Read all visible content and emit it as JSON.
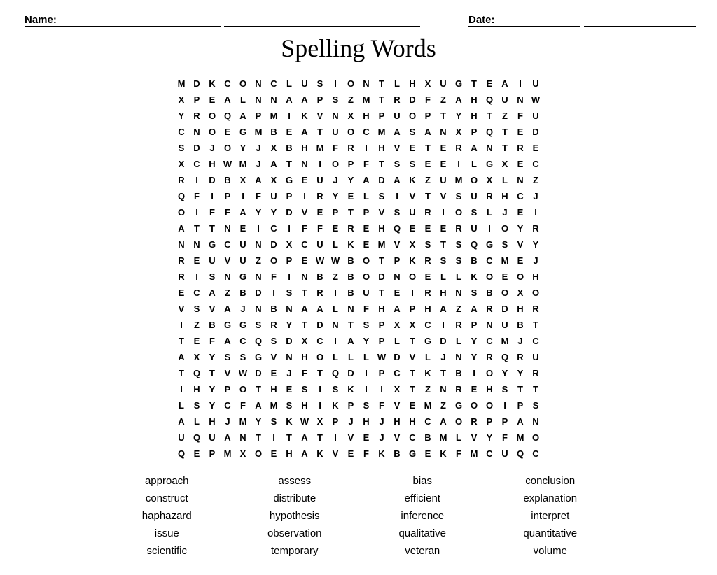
{
  "header": {
    "name_label": "Name:",
    "date_label": "Date:"
  },
  "title": "Spelling Words",
  "grid": [
    [
      "M",
      "D",
      "K",
      "C",
      "O",
      "N",
      "C",
      "L",
      "U",
      "S",
      "I",
      "O",
      "N",
      "T",
      "L",
      "H",
      "X",
      "U",
      "G",
      "T",
      "E",
      "A",
      "I",
      "U",
      "",
      ""
    ],
    [
      "X",
      "P",
      "E",
      "A",
      "L",
      "N",
      "N",
      "A",
      "A",
      "P",
      "S",
      "Z",
      "M",
      "T",
      "R",
      "D",
      "F",
      "Z",
      "A",
      "H",
      "Q",
      "U",
      "N",
      "W",
      "",
      ""
    ],
    [
      "Y",
      "R",
      "O",
      "Q",
      "A",
      "P",
      "M",
      "I",
      "K",
      "V",
      "N",
      "X",
      "H",
      "P",
      "U",
      "O",
      "P",
      "T",
      "Y",
      "H",
      "T",
      "Z",
      "F",
      "U",
      "",
      ""
    ],
    [
      "C",
      "N",
      "O",
      "E",
      "G",
      "M",
      "B",
      "E",
      "A",
      "T",
      "U",
      "O",
      "C",
      "M",
      "A",
      "S",
      "A",
      "N",
      "X",
      "P",
      "Q",
      "T",
      "E",
      "D",
      "",
      ""
    ],
    [
      "S",
      "D",
      "J",
      "O",
      "Y",
      "J",
      "X",
      "B",
      "H",
      "M",
      "F",
      "R",
      "I",
      "H",
      "V",
      "E",
      "T",
      "E",
      "R",
      "A",
      "N",
      "T",
      "R",
      "E",
      "",
      ""
    ],
    [
      "X",
      "C",
      "H",
      "W",
      "M",
      "J",
      "A",
      "T",
      "N",
      "I",
      "O",
      "P",
      "F",
      "T",
      "S",
      "S",
      "E",
      "E",
      "I",
      "L",
      "G",
      "X",
      "E",
      "C",
      "",
      ""
    ],
    [
      "R",
      "I",
      "D",
      "B",
      "X",
      "A",
      "X",
      "G",
      "E",
      "U",
      "J",
      "Y",
      "A",
      "D",
      "A",
      "K",
      "Z",
      "U",
      "M",
      "O",
      "X",
      "L",
      "N",
      "Z",
      "",
      ""
    ],
    [
      "Q",
      "F",
      "I",
      "P",
      "I",
      "F",
      "U",
      "P",
      "I",
      "R",
      "Y",
      "E",
      "L",
      "S",
      "I",
      "V",
      "T",
      "V",
      "S",
      "U",
      "R",
      "H",
      "C",
      "J",
      "",
      ""
    ],
    [
      "O",
      "I",
      "F",
      "F",
      "A",
      "Y",
      "Y",
      "D",
      "V",
      "E",
      "P",
      "T",
      "P",
      "V",
      "S",
      "U",
      "R",
      "I",
      "O",
      "S",
      "L",
      "J",
      "E",
      "I",
      "",
      ""
    ],
    [
      "A",
      "T",
      "T",
      "N",
      "E",
      "I",
      "C",
      "I",
      "F",
      "F",
      "E",
      "R",
      "E",
      "H",
      "Q",
      "E",
      "E",
      "E",
      "R",
      "U",
      "I",
      "O",
      "Y",
      "R",
      "",
      ""
    ],
    [
      "N",
      "N",
      "G",
      "C",
      "U",
      "N",
      "D",
      "X",
      "C",
      "U",
      "L",
      "K",
      "E",
      "M",
      "V",
      "X",
      "S",
      "T",
      "S",
      "Q",
      "G",
      "S",
      "V",
      "Y",
      "",
      ""
    ],
    [
      "R",
      "E",
      "U",
      "V",
      "U",
      "Z",
      "O",
      "P",
      "E",
      "W",
      "W",
      "B",
      "O",
      "T",
      "P",
      "K",
      "R",
      "S",
      "S",
      "B",
      "C",
      "M",
      "E",
      "J",
      "",
      ""
    ],
    [
      "R",
      "I",
      "S",
      "N",
      "G",
      "N",
      "F",
      "I",
      "N",
      "B",
      "Z",
      "B",
      "O",
      "D",
      "N",
      "O",
      "E",
      "L",
      "L",
      "K",
      "O",
      "E",
      "O",
      "H",
      "",
      ""
    ],
    [
      "E",
      "C",
      "A",
      "Z",
      "B",
      "D",
      "I",
      "S",
      "T",
      "R",
      "I",
      "B",
      "U",
      "T",
      "E",
      "I",
      "R",
      "H",
      "N",
      "S",
      "B",
      "O",
      "X",
      "O",
      "",
      ""
    ],
    [
      "V",
      "S",
      "V",
      "A",
      "J",
      "N",
      "B",
      "N",
      "A",
      "A",
      "L",
      "N",
      "F",
      "H",
      "A",
      "P",
      "H",
      "A",
      "Z",
      "A",
      "R",
      "D",
      "H",
      "R",
      "",
      ""
    ],
    [
      "I",
      "Z",
      "B",
      "G",
      "G",
      "S",
      "R",
      "Y",
      "T",
      "D",
      "N",
      "T",
      "S",
      "P",
      "X",
      "X",
      "C",
      "I",
      "R",
      "P",
      "N",
      "U",
      "B",
      "T",
      "",
      ""
    ],
    [
      "T",
      "E",
      "F",
      "A",
      "C",
      "Q",
      "S",
      "D",
      "X",
      "C",
      "I",
      "A",
      "Y",
      "P",
      "L",
      "T",
      "G",
      "D",
      "L",
      "Y",
      "C",
      "M",
      "J",
      "C",
      "",
      ""
    ],
    [
      "A",
      "X",
      "Y",
      "S",
      "S",
      "G",
      "V",
      "N",
      "H",
      "O",
      "L",
      "L",
      "L",
      "W",
      "D",
      "V",
      "L",
      "J",
      "N",
      "Y",
      "R",
      "Q",
      "R",
      "U",
      "",
      ""
    ],
    [
      "T",
      "Q",
      "T",
      "V",
      "W",
      "D",
      "E",
      "J",
      "F",
      "T",
      "Q",
      "D",
      "I",
      "P",
      "C",
      "T",
      "K",
      "T",
      "B",
      "I",
      "O",
      "Y",
      "Y",
      "R",
      "",
      ""
    ],
    [
      "I",
      "H",
      "Y",
      "P",
      "O",
      "T",
      "H",
      "E",
      "S",
      "I",
      "S",
      "K",
      "I",
      "I",
      "X",
      "T",
      "Z",
      "N",
      "R",
      "E",
      "H",
      "S",
      "T",
      "T",
      "",
      ""
    ],
    [
      "L",
      "S",
      "Y",
      "C",
      "F",
      "A",
      "M",
      "S",
      "H",
      "I",
      "K",
      "P",
      "S",
      "F",
      "V",
      "E",
      "M",
      "Z",
      "G",
      "O",
      "O",
      "I",
      "P",
      "S",
      "",
      ""
    ],
    [
      "A",
      "L",
      "H",
      "J",
      "M",
      "Y",
      "S",
      "K",
      "W",
      "X",
      "P",
      "J",
      "H",
      "J",
      "H",
      "H",
      "C",
      "A",
      "O",
      "R",
      "P",
      "P",
      "A",
      "N",
      "",
      ""
    ],
    [
      "U",
      "Q",
      "U",
      "A",
      "N",
      "T",
      "I",
      "T",
      "A",
      "T",
      "I",
      "V",
      "E",
      "J",
      "V",
      "C",
      "B",
      "M",
      "L",
      "V",
      "Y",
      "F",
      "M",
      "O",
      "",
      ""
    ],
    [
      "Q",
      "E",
      "P",
      "M",
      "X",
      "O",
      "E",
      "H",
      "A",
      "K",
      "V",
      "E",
      "F",
      "K",
      "B",
      "G",
      "E",
      "K",
      "F",
      "M",
      "C",
      "U",
      "Q",
      "C",
      "",
      ""
    ]
  ],
  "words": [
    "approach",
    "assess",
    "bias",
    "conclusion",
    "construct",
    "distribute",
    "efficient",
    "explanation",
    "haphazard",
    "hypothesis",
    "inference",
    "interpret",
    "issue",
    "observation",
    "qualitative",
    "quantitative",
    "scientific",
    "temporary",
    "veteran",
    "volume"
  ]
}
